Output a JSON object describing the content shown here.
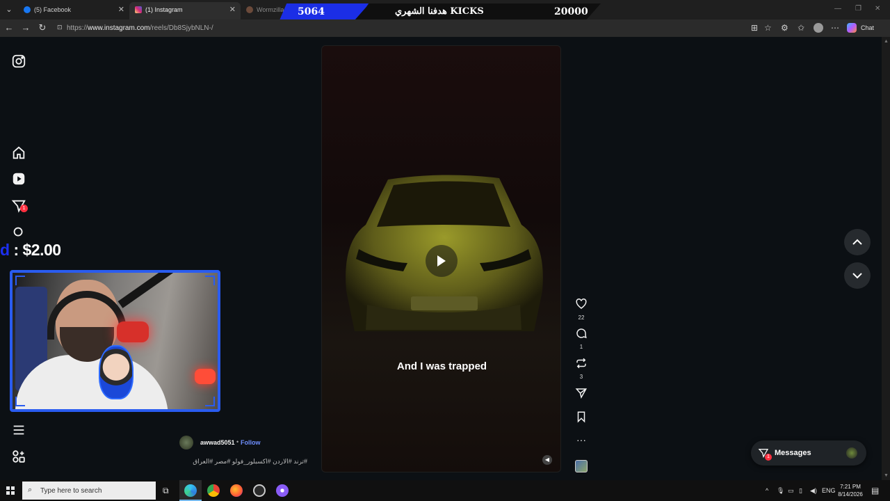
{
  "browser": {
    "tabs": [
      {
        "title": "(5) Facebook",
        "favicon": "facebook-icon",
        "color": "#1877f2"
      },
      {
        "title": "(1) Instagram",
        "favicon": "instagram-icon",
        "color": "#e1306c",
        "active": true
      },
      {
        "title": "Wormzilla.io –",
        "favicon": "wormzilla-icon",
        "color": "#6b4a3a"
      }
    ],
    "url_prefix": "https://",
    "url_host": "www.instagram.com",
    "url_path": "/reels/Db8SjybNLN-/",
    "chat_label": "Chat"
  },
  "stream_overlay": {
    "count_left": "5064",
    "goal_text": "هدفنا الشهري KICKS",
    "count_right": "20000",
    "donation_prefix": "d",
    "donation_text": " : $2.00",
    "accent": "#1c2ff0"
  },
  "sidebar": {
    "notification_badge": "1"
  },
  "reel": {
    "caption": "And I was trapped",
    "username": "awwad5051",
    "separator": "•",
    "follow_label": "Follow",
    "hashtags": "#ترند #الاردن #اكسبلور_فولو #مصر #العراق",
    "likes": "22",
    "comments": "1",
    "reposts": "3"
  },
  "messages": {
    "label": "Messages",
    "badge": "1"
  },
  "taskbar": {
    "search_placeholder": "Type here to search",
    "language": "ENG",
    "time": "7:21 PM",
    "date": "8/14/2026"
  }
}
